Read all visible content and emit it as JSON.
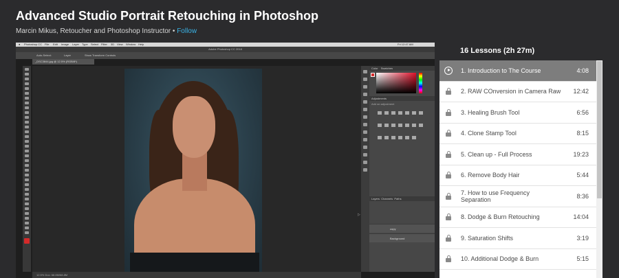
{
  "course": {
    "title": "Advanced Studio Portrait Retouching in Photoshop",
    "author": "Marcin Mikus, Retoucher and Photoshop Instructor",
    "separator": "•",
    "follow_label": "Follow"
  },
  "player": {
    "mac_menu": [
      "Photoshop CC",
      "File",
      "Edit",
      "Image",
      "Layer",
      "Type",
      "Select",
      "Filter",
      "3D",
      "View",
      "Window",
      "Help"
    ],
    "mac_clock": "Fri 12:47 AM",
    "app_title": "Adobe Photoshop CC 2018",
    "options": [
      "Auto-Select:",
      "Layer",
      "Show Transform Controls"
    ],
    "doc_tab": "_DSC3844.jpg @ 12.5% (RGB/8*)",
    "panel_tabs": [
      "Color",
      "Swatches"
    ],
    "adjustments_title": "Adjustments",
    "adjustments_sub": "Add an adjustment",
    "layers_tabs": [
      "Layers",
      "Channels",
      "Paths"
    ],
    "layers": [
      "copy",
      "Background"
    ],
    "status": "12.5%   Doc: 68.8M/68.8M"
  },
  "lessons": {
    "header": "16 Lessons (2h 27m)",
    "items": [
      {
        "label": "1. Introduction to The Course",
        "duration": "4:08",
        "active": true
      },
      {
        "label": "2. RAW COnversion in Camera Raw",
        "duration": "12:42",
        "active": false
      },
      {
        "label": "3. Healing Brush Tool",
        "duration": "6:56",
        "active": false
      },
      {
        "label": "4. Clone Stamp Tool",
        "duration": "8:15",
        "active": false
      },
      {
        "label": "5. Clean up - Full Process",
        "duration": "19:23",
        "active": false
      },
      {
        "label": "6. Remove Body Hair",
        "duration": "5:44",
        "active": false
      },
      {
        "label": "7. How to use Frequency Separation",
        "duration": "8:36",
        "active": false
      },
      {
        "label": "8. Dodge & Burn Retouching",
        "duration": "14:04",
        "active": false
      },
      {
        "label": "9. Saturation Shifts",
        "duration": "3:19",
        "active": false
      },
      {
        "label": "10. Additional Dodge & Burn",
        "duration": "5:15",
        "active": false
      }
    ]
  },
  "colors": {
    "accent": "#3ab3e6",
    "active_lesson": "#7d7d7d",
    "background": "#2b2b2d"
  }
}
